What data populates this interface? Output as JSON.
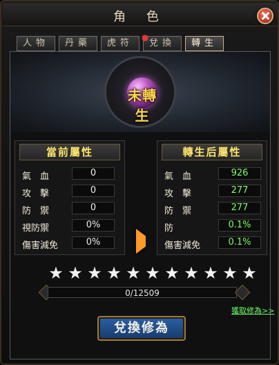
{
  "window": {
    "title": "角 色"
  },
  "tabs": [
    {
      "label": "人物",
      "active": false,
      "badge": false
    },
    {
      "label": "丹藥",
      "active": false,
      "badge": false
    },
    {
      "label": "虎符",
      "active": false,
      "badge": false
    },
    {
      "label": "兌換",
      "active": false,
      "badge": true
    },
    {
      "label": "轉生",
      "active": true,
      "badge": false
    }
  ],
  "emblem": {
    "label": "未轉生"
  },
  "current_attributes": {
    "title": "當前屬性",
    "rows": [
      {
        "label": "氣　血",
        "value": "0"
      },
      {
        "label": "攻　擊",
        "value": "0"
      },
      {
        "label": "防　禦",
        "value": "0"
      },
      {
        "label": "視防禦",
        "value": "0%"
      },
      {
        "label": "傷害減免",
        "value": "0%"
      }
    ]
  },
  "after_attributes": {
    "title": "轉生后屬性",
    "rows": [
      {
        "label": "氣　血",
        "value": "926"
      },
      {
        "label": "攻　擊",
        "value": "277"
      },
      {
        "label": "防　禦",
        "value": "277"
      },
      {
        "label": "防",
        "value": "0.1%"
      },
      {
        "label": "傷害減免",
        "value": "0.1%"
      }
    ]
  },
  "progress": {
    "text": "0/12509",
    "fraction": 0.0
  },
  "stars": {
    "count": 11,
    "filled": 11,
    "icon": "star-icon"
  },
  "links": {
    "get_cultivation": "獲取修為>>"
  },
  "buttons": {
    "exchange": "兌換修為"
  },
  "colors": {
    "accent_gold": "#ffe46b",
    "value_green": "#7cff62",
    "button_blue": "#2a61a6",
    "arrow_orange": "#ff9a29"
  }
}
